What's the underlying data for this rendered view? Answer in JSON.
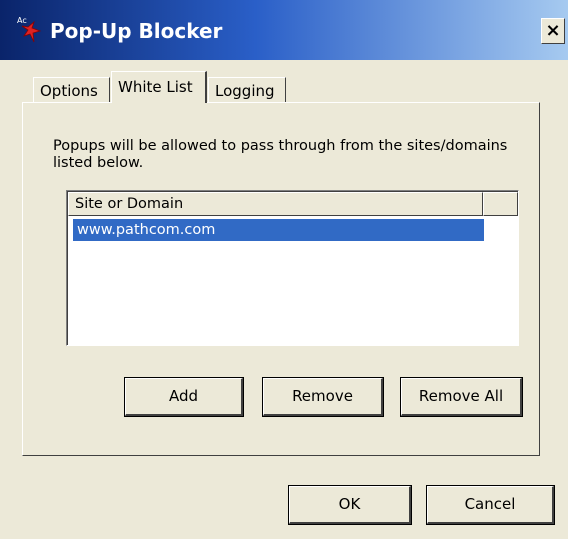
{
  "window": {
    "title": "Pop-Up Blocker",
    "close_label": "×"
  },
  "tabs": [
    {
      "label": "Options",
      "active": false
    },
    {
      "label": "White List",
      "active": true
    },
    {
      "label": "Logging",
      "active": false
    }
  ],
  "whitelist": {
    "description": "Popups will be allowed to pass through from the sites/domains listed below.",
    "columns": [
      "Site or Domain",
      ""
    ],
    "rows": [
      {
        "site": "www.pathcom.com",
        "selected": true
      }
    ]
  },
  "buttons": {
    "add": "Add",
    "remove": "Remove",
    "remove_all": "Remove All",
    "ok": "OK",
    "cancel": "Cancel"
  },
  "colors": {
    "title_bar": "#0a246a",
    "selection": "#316ac5",
    "dialog_bg": "#ece9d8"
  },
  "icons": {
    "app": "popup-blocker-app-icon",
    "close": "close-icon"
  }
}
